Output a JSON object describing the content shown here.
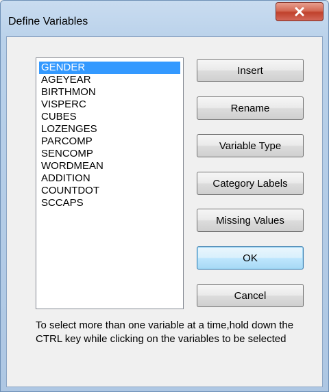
{
  "window": {
    "title": "Define Variables",
    "close_icon": "close-icon"
  },
  "variables": {
    "items": [
      "GENDER",
      "AGEYEAR",
      "BIRTHMON",
      "VISPERC",
      "CUBES",
      "LOZENGES",
      "PARCOMP",
      "SENCOMP",
      "WORDMEAN",
      "ADDITION",
      "COUNTDOT",
      "SCCAPS"
    ],
    "selected": "GENDER"
  },
  "buttons": {
    "insert": "Insert",
    "rename": "Rename",
    "variable_type": "Variable Type",
    "category_labels": "Category Labels",
    "missing_values": "Missing Values",
    "ok": "OK",
    "cancel": "Cancel"
  },
  "hint": "To select more than one variable at a time,hold down the CTRL key while clicking on the variables to be selected",
  "colors": {
    "selection": "#3399ff",
    "close_button": "#c0412c",
    "title_bar": "#b9d1ea"
  }
}
